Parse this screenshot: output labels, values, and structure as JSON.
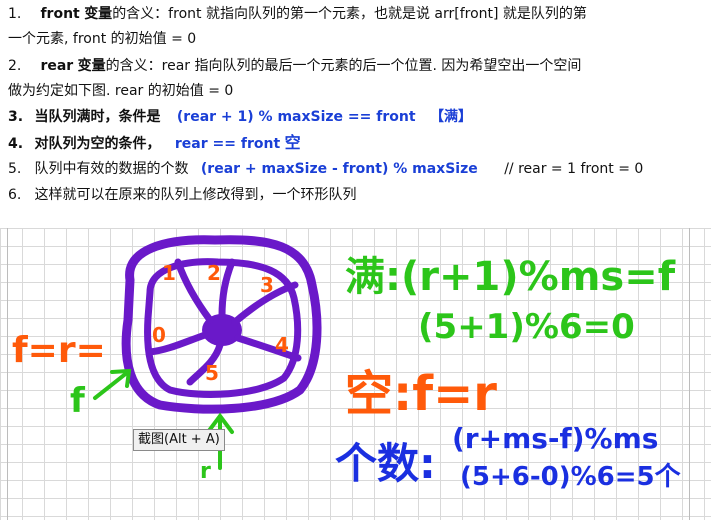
{
  "notes": {
    "line1": {
      "num": "1.",
      "key": "front",
      "bold_word": "变量",
      "rest": "的含义：front 就指向队列的第一个元素，也就是说 arr[front] 就是队列的第",
      "cont": "一个元素, front 的初始值 = 0"
    },
    "line2": {
      "num": "2.",
      "key": "rear",
      "bold_word": "变量",
      "rest": "的含义：rear 指向队列的最后一个元素的后一个位置. 因为希望空出一个空间",
      "cont": "做为约定如下图. rear 的初始值 = 0"
    },
    "line3": {
      "num": "3.",
      "text": "当队列满时，条件是",
      "formula": "(rear + 1) % maxSize == front",
      "tag": "【满】"
    },
    "line4": {
      "num": "4.",
      "text": "对队列为空的条件，",
      "formula": "rear == front",
      "tag": "空"
    },
    "line5": {
      "num": "5.",
      "text": "队列中有效的数据的个数",
      "formula": "(rear + maxSize - front) % maxSize",
      "comment": "// rear = 1 front = 0"
    },
    "line6": {
      "num": "6.",
      "text": "这样就可以在原来的队列上修改得到，一个环形队列"
    }
  },
  "handwriting": {
    "full_label": "满:(r+1)%ms=f",
    "full_example": "(5+1)%6=0",
    "empty_label": "空:f=r",
    "count_label": "个数:",
    "count_formula": "(r+ms-f)%ms",
    "count_example": "(5+6-0)%6=5个",
    "f_eq_r": "f=r=",
    "f_arrow": "f",
    "r_arrow": "r",
    "slots": [
      "0",
      "1",
      "2",
      "3",
      "4",
      "5"
    ]
  },
  "tooltip": {
    "text": "截图(Alt + A)"
  },
  "colors": {
    "green": "#2cc51a",
    "orange": "#ff5a0a",
    "purple": "#6a19c9",
    "blue": "#1a2fe0"
  }
}
